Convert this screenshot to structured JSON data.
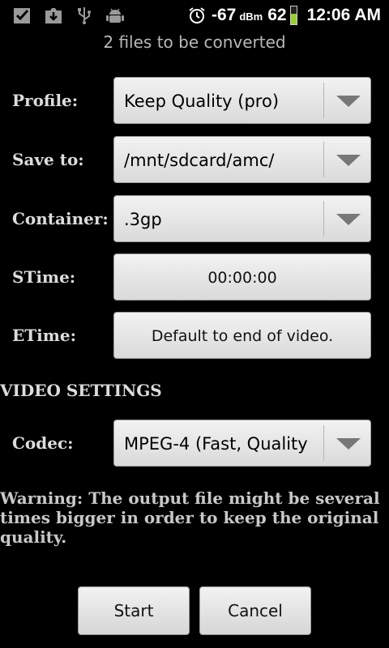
{
  "status_bar": {
    "icons": [
      "checkbox-icon",
      "download-icon",
      "usb-icon",
      "android-debug-icon",
      "alarm-clock-icon",
      "battery-icon"
    ],
    "signal_value": "-67",
    "signal_unit": "dBm",
    "battery_level": "62",
    "time": "12:06 AM"
  },
  "subtitle": "2  files to be converted",
  "fields": {
    "profile": {
      "label": "Profile:",
      "value": "Keep Quality (pro)"
    },
    "save_to": {
      "label": "Save to:",
      "value": "/mnt/sdcard/amc/"
    },
    "container": {
      "label": "Container:",
      "value": ".3gp"
    },
    "stime": {
      "label": "STime:",
      "value": "00:00:00"
    },
    "etime": {
      "label": "ETime:",
      "value": "Default to end of video."
    }
  },
  "video_settings": {
    "heading": "VIDEO SETTINGS",
    "codec": {
      "label": "Codec:",
      "value": "MPEG-4 (Fast, Quality"
    }
  },
  "warning": "Warning: The output file might be several times bigger in order to keep the original quality.",
  "actions": {
    "start": "Start",
    "cancel": "Cancel"
  }
}
